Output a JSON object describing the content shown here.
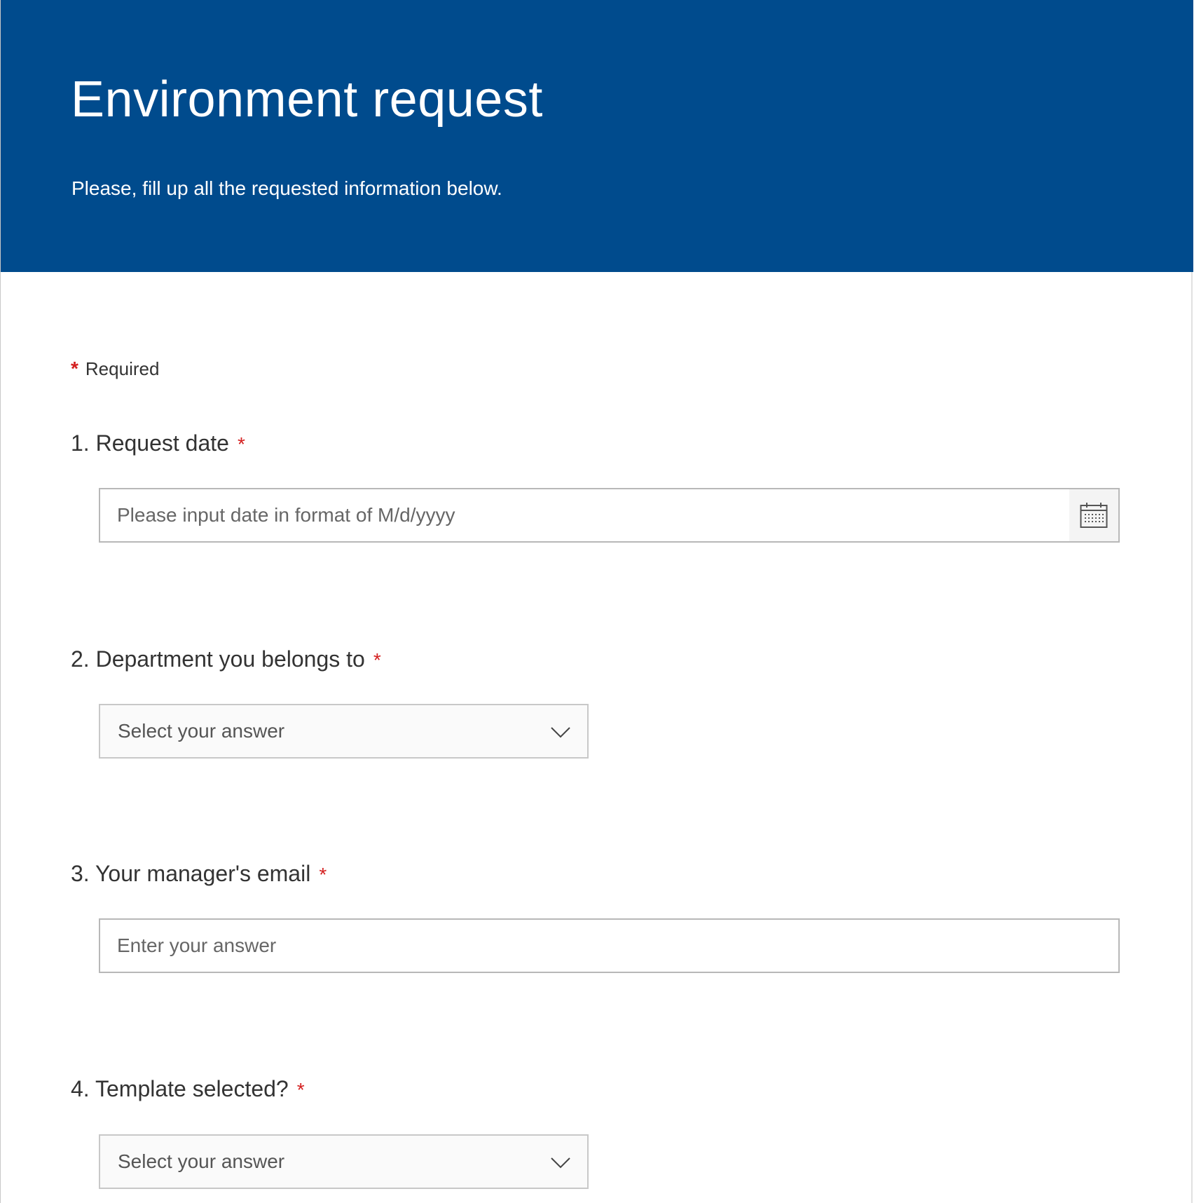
{
  "header": {
    "title": "Environment request",
    "subtitle": "Please, fill up all the requested information below.",
    "background_color": "#004b8d"
  },
  "required_note": {
    "marker": "*",
    "text": "Required"
  },
  "questions": [
    {
      "number_label": "1. Request date",
      "required_marker": "*",
      "type": "date",
      "placeholder": "Please input date in format of M/d/yyyy",
      "value": "",
      "icon": "calendar-icon"
    },
    {
      "number_label": "2. Department you belongs to",
      "required_marker": "*",
      "type": "dropdown",
      "selected": "Select your answer",
      "icon": "chevron-down-icon"
    },
    {
      "number_label": "3. Your manager's email",
      "required_marker": "*",
      "type": "text",
      "placeholder": "Enter your answer",
      "value": ""
    },
    {
      "number_label": "4. Template selected?",
      "required_marker": "*",
      "type": "dropdown",
      "selected": "Select your answer",
      "icon": "chevron-down-icon"
    }
  ],
  "colors": {
    "accent": "#004b8d",
    "required_star": "#d42020",
    "text": "#333333",
    "field_border": "#b8b8b8"
  }
}
